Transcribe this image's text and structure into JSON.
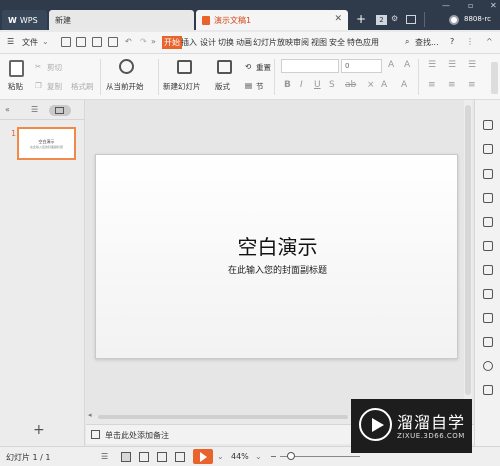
{
  "titlebar": {
    "tabs": [
      {
        "label": "WPS",
        "logo": "W"
      },
      {
        "label": "新建"
      },
      {
        "label": "演示文稿1"
      }
    ],
    "tab_count": "2",
    "user": "8808-rc"
  },
  "menubar": {
    "file_label": "文件",
    "tabs": [
      "开始",
      "插入",
      "设计",
      "切换",
      "动画",
      "幻灯片放映",
      "审阅",
      "视图",
      "安全",
      "特色应用"
    ],
    "search_label": "查找...",
    "help_label": "?"
  },
  "ribbon": {
    "paste": "粘贴",
    "cut": "剪切",
    "copy": "复制",
    "format_painter": "格式刷",
    "from_current": "从当前开始",
    "new_slide": "新建幻灯片",
    "layout": "版式",
    "reset": "重置",
    "section": "节",
    "font_size": "0"
  },
  "leftpanel": {
    "slide_number": "1",
    "thumb_title": "空白演示",
    "thumb_subtitle": "在此输入您的封面副标题"
  },
  "slide": {
    "title": "空白演示",
    "subtitle": "在此输入您的封面副标题"
  },
  "notes": {
    "placeholder": "单击此处添加备注"
  },
  "status": {
    "slide_indicator": "幻灯片 1 / 1",
    "zoom": "44%"
  },
  "watermark": {
    "name": "溜溜自学",
    "url": "ZIXUE.3D66.COM"
  },
  "colors": {
    "accent": "#e9642c",
    "titlebar": "#2f3a4a"
  }
}
